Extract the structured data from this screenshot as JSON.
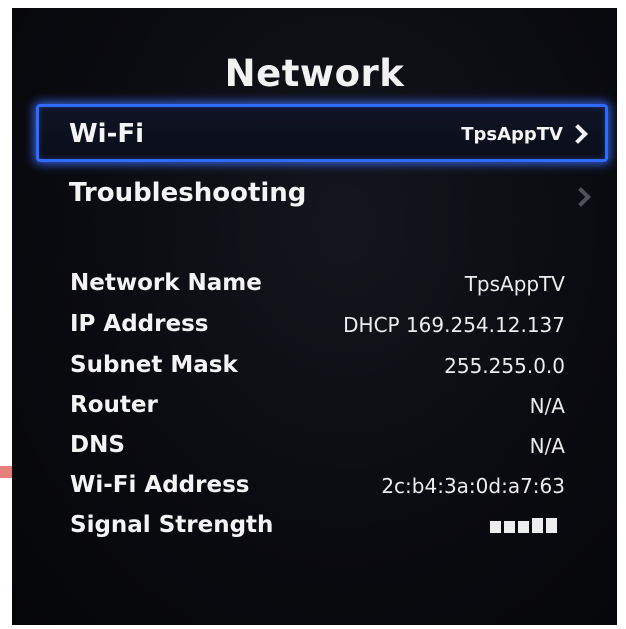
{
  "title": "Network",
  "wifi": {
    "label": "Wi-Fi",
    "value": "TpsAppTV"
  },
  "troubleshooting": {
    "label": "Troubleshooting"
  },
  "info": [
    {
      "label": "Network Name",
      "value": "TpsAppTV"
    },
    {
      "label": "IP Address",
      "value": "DHCP 169.254.12.137"
    },
    {
      "label": "Subnet Mask",
      "value": "255.255.0.0"
    },
    {
      "label": "Router",
      "value": "N/A"
    },
    {
      "label": "DNS",
      "value": "N/A"
    },
    {
      "label": "Wi-Fi Address",
      "value": "2c:b4:3a:0d:a7:63"
    },
    {
      "label": "Signal Strength",
      "signal_bars": 5
    }
  ],
  "colors": {
    "highlight": "#2f6bff",
    "annotation_arrow": "#d9534f"
  }
}
